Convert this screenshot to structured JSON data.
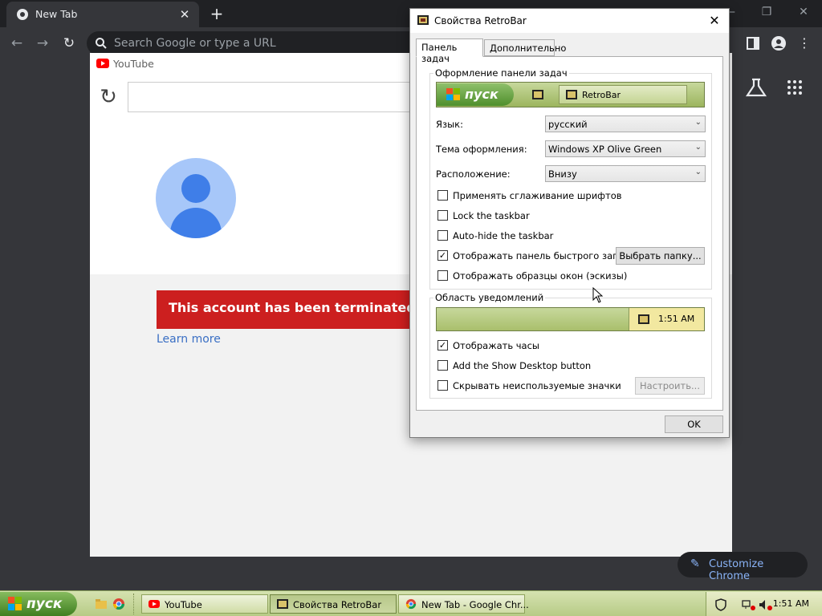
{
  "chrome": {
    "tab_title": "New Tab",
    "omnibox_placeholder": "Search Google or type a URL",
    "customize_label": "Customize Chrome",
    "icons": [
      "chrome-icon",
      "close-icon",
      "plus-icon",
      "back-icon",
      "forward-icon",
      "reload-icon",
      "search-icon",
      "sidebar-icon",
      "profile-icon",
      "menu-icon",
      "labs-icon",
      "apps-grid-icon",
      "pencil-icon",
      "minimize-icon",
      "restore-icon"
    ]
  },
  "page": {
    "site_name": "YouTube",
    "banner_text": "This account has been terminated for a vi",
    "learn_more": "Learn more",
    "banner_color": "#cc1f1f",
    "link_color": "#3a6fc4"
  },
  "dialog": {
    "title": "Свойства RetroBar",
    "tabs": [
      {
        "label": "Панель задач",
        "active": true
      },
      {
        "label": "Дополнительно",
        "active": false
      }
    ],
    "appearance_group": {
      "title": "Оформление панели задач",
      "preview_start": "пуск",
      "preview_task": "RetroBar"
    },
    "fields": [
      {
        "label": "Язык:",
        "value": "русский"
      },
      {
        "label": "Тема оформления:",
        "value": "Windows XP Olive Green"
      },
      {
        "label": "Расположение:",
        "value": "Внизу"
      }
    ],
    "checkboxes": [
      {
        "label": "Применять сглаживание шрифтов",
        "checked": false
      },
      {
        "label": "Lock the taskbar",
        "checked": false
      },
      {
        "label": "Auto-hide the taskbar",
        "checked": false
      },
      {
        "label": "Отображать панель быстрого запуска",
        "checked": true
      },
      {
        "label": "Отображать образцы окон (эскизы)",
        "checked": false
      }
    ],
    "choose_folder_button": "Выбрать папку...",
    "notification_group": {
      "title": "Область уведомлений",
      "preview_clock": "1:51 AM"
    },
    "tray_checkboxes": [
      {
        "label": "Отображать часы",
        "checked": true
      },
      {
        "label": "Add the Show Desktop button",
        "checked": false
      },
      {
        "label": "Скрывать неиспользуемые значки",
        "checked": false
      }
    ],
    "customize_button": "Настроить...",
    "ok_button": "OK",
    "check_mark": "✓"
  },
  "taskbar": {
    "start_label": "пуск",
    "tasks": [
      {
        "label": "YouTube",
        "active": false
      },
      {
        "label": "Свойства RetroBar",
        "active": true
      },
      {
        "label": "New Tab - Google Chr...",
        "active": false
      }
    ],
    "clock": "1:51 AM",
    "theme_color": "#b7cb86"
  }
}
